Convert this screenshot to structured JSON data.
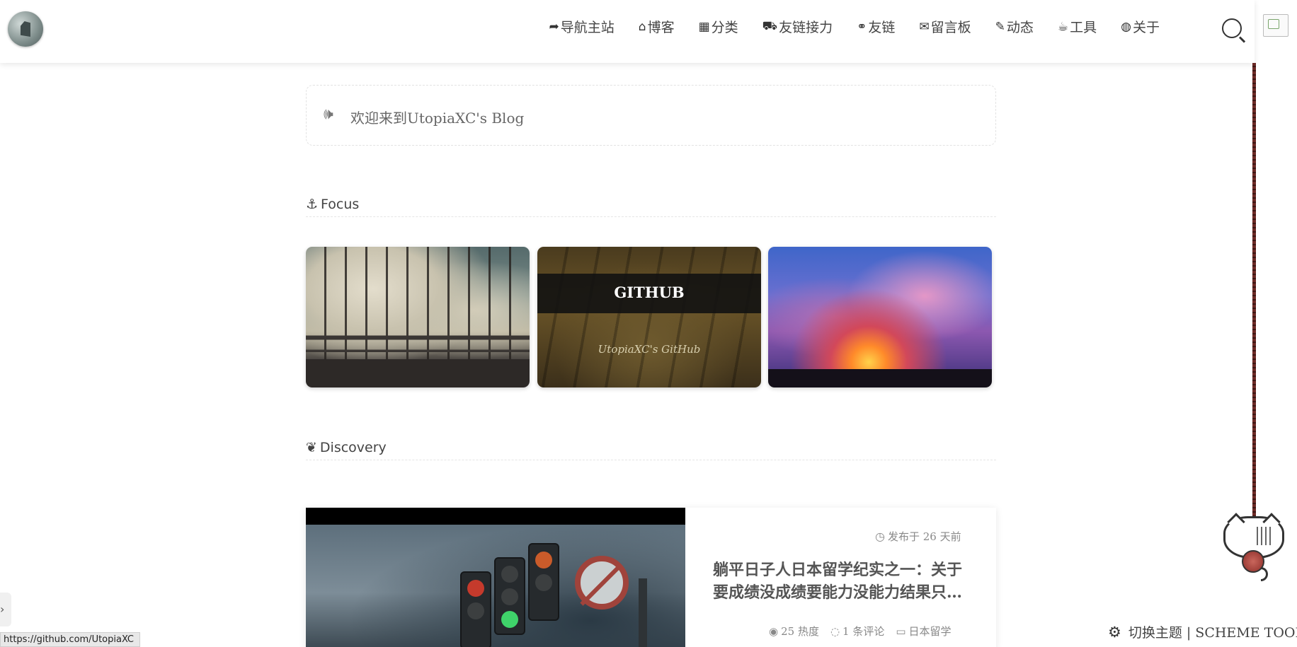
{
  "header": {
    "nav": [
      {
        "icon": "share-arrow-icon",
        "glyph": "➦",
        "label": "导航主站"
      },
      {
        "icon": "home-icon",
        "glyph": "⌂",
        "label": "博客"
      },
      {
        "icon": "grid-icon",
        "glyph": "▦",
        "label": "分类"
      },
      {
        "icon": "train-icon",
        "glyph": "⛟",
        "label": "友链接力"
      },
      {
        "icon": "link-icon",
        "glyph": "⚭",
        "label": "友链"
      },
      {
        "icon": "comments-icon",
        "glyph": "✉",
        "label": "留言板"
      },
      {
        "icon": "feather-icon",
        "glyph": "✎",
        "label": "动态"
      },
      {
        "icon": "coffee-icon",
        "glyph": "☕",
        "label": "工具"
      },
      {
        "icon": "globe-icon",
        "glyph": "◍",
        "label": "关于"
      }
    ]
  },
  "notice": {
    "icon": "volume-icon",
    "glyph": "🕪",
    "text": "欢迎来到UtopiaXC's Blog"
  },
  "focus": {
    "icon": "anchor-icon",
    "glyph": "⚓",
    "title": "Focus",
    "cards": [
      {
        "title": "",
        "subtitle": ""
      },
      {
        "title": "GITHUB",
        "subtitle": "UtopiaXC's GitHub"
      },
      {
        "title": "",
        "subtitle": ""
      }
    ]
  },
  "discovery": {
    "icon": "leaf-icon",
    "glyph": "❦",
    "title": "Discovery"
  },
  "article": {
    "date_glyph": "◷",
    "date": "发布于 26 天前",
    "title": "躺平日子人日本留学纪实之一：关于要成绩没成绩要能力没能力结果只…",
    "views_glyph": "◉",
    "views": "25 热度",
    "comments_glyph": "◌",
    "comments": "1 条评论",
    "category_glyph": "▭",
    "category": "日本留学"
  },
  "scheme_tool": {
    "glyph": "⚙",
    "label": "切换主题 | SCHEME TOOL"
  },
  "status_bar": {
    "url": "https://github.com/UtopiaXC"
  },
  "side_toggle": {
    "glyph": "›"
  },
  "colors": {
    "text": "#444444",
    "rope": "#6e2b27",
    "card_band": "#121212"
  }
}
